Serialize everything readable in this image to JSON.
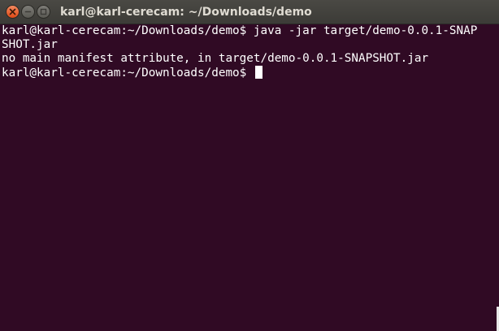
{
  "window": {
    "title": "karl@karl-cerecam: ~/Downloads/demo"
  },
  "terminal": {
    "lines": [
      "karl@karl-cerecam:~/Downloads/demo$ java -jar target/demo-0.0.1-SNAP",
      "SHOT.jar",
      "no main manifest attribute, in target/demo-0.0.1-SNAPSHOT.jar"
    ],
    "prompt": "karl@karl-cerecam:~/Downloads/demo$ "
  },
  "colors": {
    "background": "#300a24",
    "text": "#ffffff",
    "titlebar": "#3c3b37",
    "close_button": "#df4a16"
  },
  "icons": [
    "close-icon",
    "minimize-icon",
    "maximize-icon"
  ]
}
